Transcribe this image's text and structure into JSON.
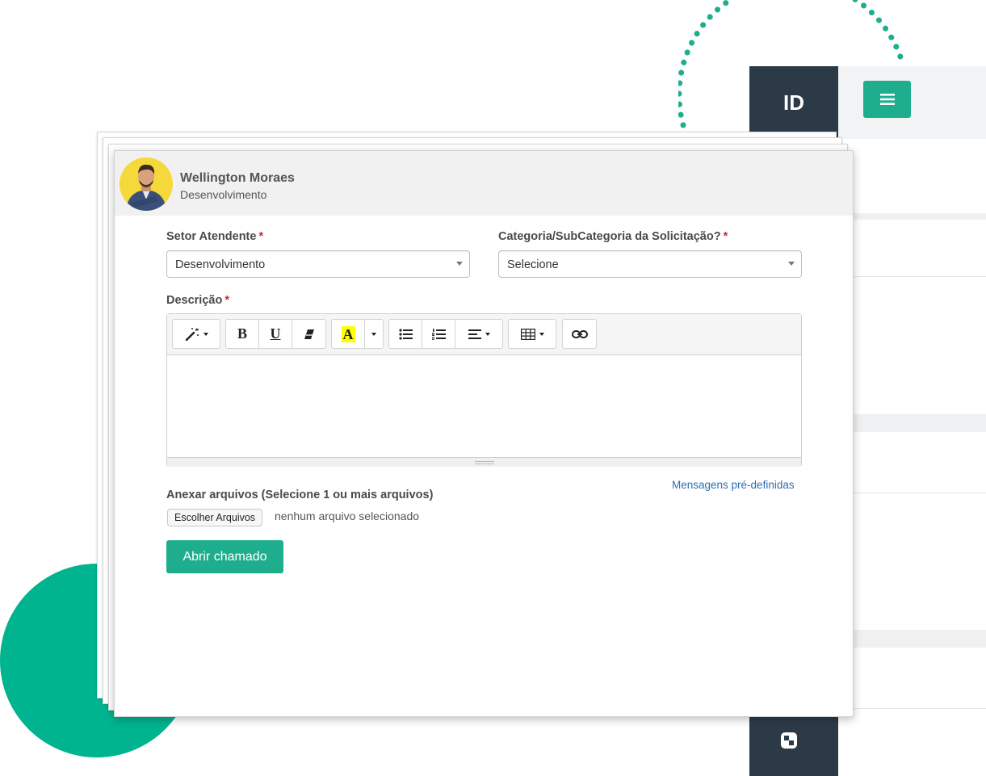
{
  "background_app": {
    "logo_text": "ID",
    "menu_icon": "hamburger-icon",
    "sidebar_icon": "dashboard-icon",
    "accent_color": "#1fae8d",
    "sidebar_color": "#2c3a48"
  },
  "user": {
    "name": "Wellington Moraes",
    "department": "Desenvolvimento"
  },
  "form": {
    "setor": {
      "label": "Setor Atendente",
      "required_mark": "*",
      "value": "Desenvolvimento"
    },
    "categoria": {
      "label": "Categoria/SubCategoria da Solicitação?",
      "required_mark": "*",
      "value": "Selecione"
    },
    "descricao": {
      "label": "Descrição",
      "required_mark": "*",
      "toolbar": {
        "style_icon": "magic-wand-icon",
        "bold": "B",
        "underline": "U",
        "clear_format_icon": "eraser-icon",
        "font_color": "A",
        "unordered_list_icon": "bullet-list-icon",
        "ordered_list_icon": "numbered-list-icon",
        "paragraph_icon": "align-left-icon",
        "table_icon": "table-icon",
        "link_icon": "link-icon"
      },
      "content": ""
    },
    "predefined_link": "Mensagens pré-definidas",
    "attachments": {
      "label": "Anexar arquivos (Selecione 1 ou mais arquivos)",
      "button": "Escolher Arquivos",
      "status": "nenhum arquivo selecionado"
    },
    "submit": "Abrir chamado"
  }
}
